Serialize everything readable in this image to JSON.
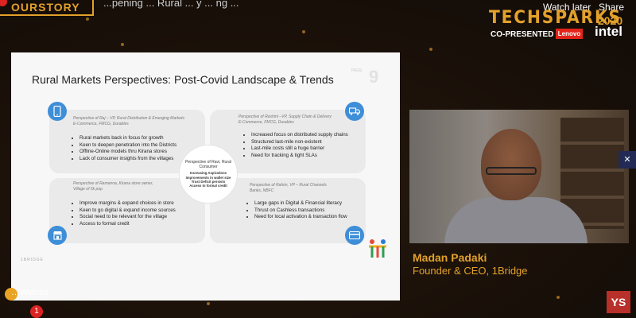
{
  "header": {
    "brand_badge": "OURSTORY",
    "video_title": "...pening ... Rural ... y ... ng ...",
    "watch_later": "Watch later",
    "share": "Share"
  },
  "event": {
    "name": "TECHSPARKS",
    "year": "2020",
    "copresented": "CO-PRESENTED BY",
    "sponsor1": "Lenovo",
    "sponsor2": "intel"
  },
  "slide": {
    "title": "Rural Markets Perspectives: Post-Covid Landscape & Trends",
    "page_number": "9",
    "page_tag": "PAGE",
    "footer": "1BRIDGE",
    "quadrants": [
      {
        "perspective": "Perspective of Raj – VP, Rural Distribution & Emerging Markets\nE-Commerce, FMCG, Durables",
        "bullets": [
          "Rural markets back in focus for growth",
          "Keen to deepen penetration into the Districts",
          "Offline-Online models thru Kirana stores",
          "Lack of consumer insights from the villages"
        ]
      },
      {
        "perspective": "Perspective of Rashmi –VP, Supply Chain & Delivery\nE-Commerce, FMCG, Durables",
        "bullets": [
          "Increased focus on distributed supply chains",
          "Structured last-mile non-existent",
          "Last-mile costs still a huge barrier",
          "Need for tracking & tight SLAs"
        ]
      },
      {
        "perspective": "Perspective of Ramanna, Kirana store owner,\nVillage of 5k pop",
        "bullets": [
          "Improve margins & expand choices in store",
          "Keen to go digital & expand income sources",
          "Social need to be relevant for the village",
          "Access to formal credit"
        ]
      },
      {
        "perspective": "Perspective of Rahim, VP – Rural Channels\nBanks, NBFC",
        "bullets": [
          "Large gaps in Digital & Financial literacy",
          "Thrust on Cashless transactions",
          "Need for local activation & transaction flow"
        ]
      }
    ],
    "center": {
      "title": "Perspective of Ravi, Rural Consumer",
      "items": [
        "Increasing Aspirations",
        "Improvements in wallet size",
        "Trust Deficit persists",
        "Access to formal credit"
      ]
    }
  },
  "speaker": {
    "name": "Madan Padaki",
    "role": "Founder & CEO, 1Bridge"
  },
  "overlay": {
    "ys_badge": "YS",
    "chat_user": "…Welcos",
    "notification_count": "1"
  },
  "colors": {
    "accent": "#e3a12b",
    "slide_icon": "#3e8ed8",
    "lenovo": "#e2231a",
    "ys": "#b8302a"
  }
}
